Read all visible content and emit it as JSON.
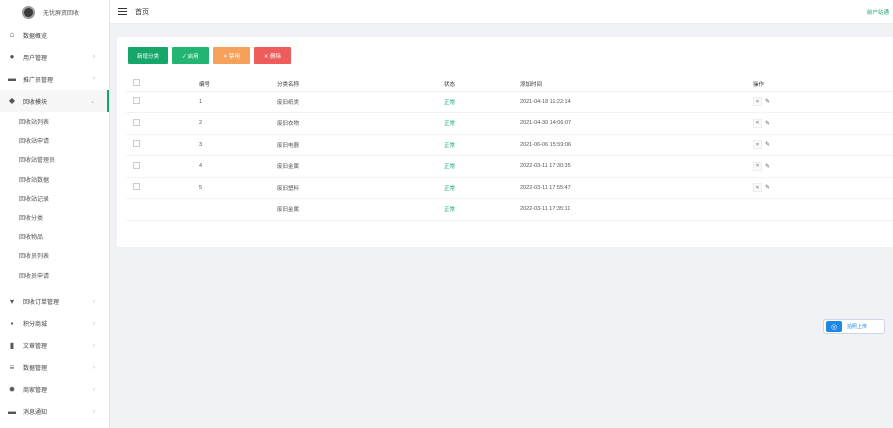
{
  "app": {
    "name": "无忧屏资回收"
  },
  "topbar": {
    "breadcrumb": "首页",
    "right_text": "前户站通"
  },
  "sidebar": {
    "items": [
      {
        "label": "数据概览",
        "icon": "home-icon",
        "arrow": ""
      },
      {
        "label": "用户管理",
        "icon": "user-icon",
        "arrow": "›"
      },
      {
        "label": "推广员管理",
        "icon": "truck-icon",
        "arrow": "›"
      },
      {
        "label": "回收模块",
        "icon": "recycle-icon",
        "arrow": "⌄"
      }
    ],
    "sub_items": [
      "回收站列表",
      "回收站申请",
      "回收站管理员",
      "回收站数据",
      "回收站记录",
      "回收分类",
      "回收物品",
      "回收员列表",
      "回收员申请"
    ],
    "bottom_items": [
      {
        "label": "回收订单管理",
        "icon": "cart-icon",
        "arrow": "›"
      },
      {
        "label": "积分商城",
        "icon": "shop-icon",
        "arrow": "›"
      },
      {
        "label": "文章管理",
        "icon": "book-icon",
        "arrow": "›"
      },
      {
        "label": "数据管理",
        "icon": "database-icon",
        "arrow": "›"
      },
      {
        "label": "商家管理",
        "icon": "gear-icon",
        "arrow": "›"
      },
      {
        "label": "消息通知",
        "icon": "message-icon",
        "arrow": "›"
      }
    ]
  },
  "toolbar": {
    "add_label": "新增分类",
    "enable_label": "✓ 启用",
    "disable_label": "✕ 禁用",
    "delete_label": "✕ 删除"
  },
  "table": {
    "headers": {
      "id": "编号",
      "name": "分类名称",
      "status": "状态",
      "time": "添加时间",
      "ops": "操作"
    },
    "rows": [
      {
        "id": "1",
        "name": "废旧纸类",
        "status": "正常",
        "time": "2021-04-18 11:22:14",
        "has_checkbox": true,
        "has_ops": true
      },
      {
        "id": "2",
        "name": "废旧衣物",
        "status": "正常",
        "time": "2021-04-30 14:06:07",
        "has_checkbox": true,
        "has_ops": true
      },
      {
        "id": "3",
        "name": "废旧电器",
        "status": "正常",
        "time": "2021-06-06 15:59:06",
        "has_checkbox": true,
        "has_ops": true
      },
      {
        "id": "4",
        "name": "废旧金属",
        "status": "正常",
        "time": "2022-03-11 17:30:35",
        "has_checkbox": true,
        "has_ops": true
      },
      {
        "id": "5",
        "name": "废旧塑料",
        "status": "正常",
        "time": "2022-03-11 17:55:47",
        "has_checkbox": true,
        "has_ops": true
      },
      {
        "id": "",
        "name": "废旧金属",
        "status": "正常",
        "time": "2022-03-11 17:35:11",
        "has_checkbox": false,
        "has_ops": false
      }
    ]
  },
  "float_button": {
    "label": "拍照上传"
  },
  "colors": {
    "accent": "#17a669",
    "disable": "#f5a15b",
    "delete": "#ee5c5c"
  }
}
